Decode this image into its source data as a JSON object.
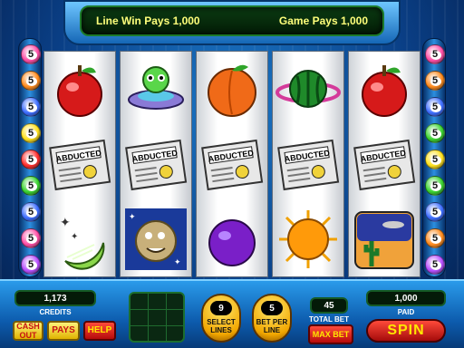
{
  "marquee": {
    "line_win": "Line Win Pays 1,000",
    "game_pays": "Game Pays 1,000"
  },
  "paylines": {
    "left": [
      {
        "num": "5",
        "color": "#ff4da6"
      },
      {
        "num": "5",
        "color": "#ff8a1c"
      },
      {
        "num": "5",
        "color": "#3b6cff"
      },
      {
        "num": "5",
        "color": "#ffe11c"
      },
      {
        "num": "5",
        "color": "#ff2d2d"
      },
      {
        "num": "5",
        "color": "#39d42f"
      },
      {
        "num": "5",
        "color": "#3b6cff"
      },
      {
        "num": "5",
        "color": "#ff4da6"
      },
      {
        "num": "5",
        "color": "#b84dff"
      }
    ],
    "right": [
      {
        "num": "5",
        "color": "#ff4da6"
      },
      {
        "num": "5",
        "color": "#ff8a1c"
      },
      {
        "num": "5",
        "color": "#3b6cff"
      },
      {
        "num": "5",
        "color": "#39d42f"
      },
      {
        "num": "5",
        "color": "#ffe11c"
      },
      {
        "num": "5",
        "color": "#39d42f"
      },
      {
        "num": "5",
        "color": "#3b6cff"
      },
      {
        "num": "5",
        "color": "#ff8a1c"
      },
      {
        "num": "5",
        "color": "#b84dff"
      }
    ]
  },
  "reels": [
    [
      "apple-symbol",
      "abducted-newspaper-symbol",
      "lime-moon-symbol"
    ],
    [
      "alien-ufo-symbol",
      "abducted-newspaper-symbol",
      "moon-face-symbol"
    ],
    [
      "peach-symbol",
      "abducted-newspaper-symbol",
      "plum-symbol"
    ],
    [
      "watermelon-planet-symbol",
      "abducted-newspaper-symbol",
      "orange-sun-symbol"
    ],
    [
      "apple-symbol",
      "abducted-newspaper-symbol",
      "desert-ufo-symbol"
    ]
  ],
  "newspaper_headline": "ABDUCTED",
  "console": {
    "credits_value": "1,173",
    "credits_label": "CREDITS",
    "cash_out": "CASH OUT",
    "pays": "PAYS",
    "help": "HELP",
    "select_lines_value": "9",
    "select_lines_label": "SELECT LINES",
    "bet_per_line_value": "5",
    "bet_per_line_label": "BET PER LINE",
    "total_bet_value": "45",
    "total_bet_label": "TOTAL BET",
    "max_bet": "MAX BET",
    "paid_value": "1,000",
    "paid_label": "PAID",
    "spin": "SPIN"
  }
}
